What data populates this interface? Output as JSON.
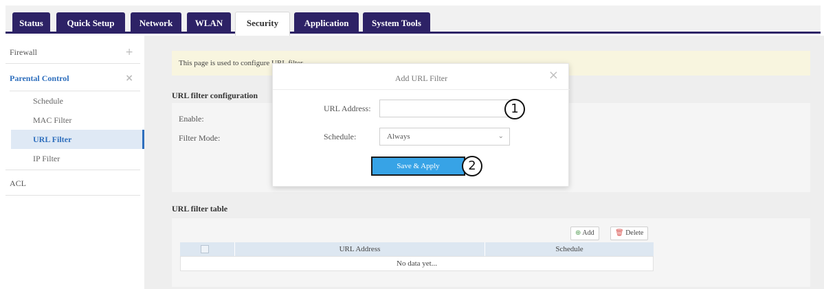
{
  "nav": {
    "tabs": [
      {
        "label": "Status"
      },
      {
        "label": "Quick Setup"
      },
      {
        "label": "Network"
      },
      {
        "label": "WLAN"
      },
      {
        "label": "Security"
      },
      {
        "label": "Application"
      },
      {
        "label": "System Tools"
      }
    ],
    "active_tab": "Security"
  },
  "sidebar": {
    "firewall": {
      "label": "Firewall",
      "sign": "+"
    },
    "parental": {
      "label": "Parental Control",
      "sign": "×"
    },
    "sub_items": [
      {
        "label": "Schedule"
      },
      {
        "label": "MAC Filter"
      },
      {
        "label": "URL Filter"
      },
      {
        "label": "IP Filter"
      }
    ],
    "acl": {
      "label": "ACL"
    }
  },
  "main": {
    "notice": "This page is used to configure URL filter.",
    "config_title": "URL filter configuration",
    "enable_label": "Enable:",
    "filter_mode_label": "Filter Mode:",
    "table_title": "URL filter table",
    "add_label": "Add",
    "delete_label": "Delete",
    "columns": [
      "URL Address",
      "Schedule"
    ],
    "empty_text": "No data yet..."
  },
  "modal": {
    "title": "Add URL Filter",
    "close": "×",
    "url_label": "URL Address:",
    "url_value": "",
    "schedule_label": "Schedule:",
    "schedule_value": "Always",
    "save_label": "Save & Apply",
    "marker_1": "1",
    "marker_2": "2"
  },
  "colors": {
    "nav_bg": "#2d2266",
    "accent": "#2f6fbd",
    "button": "#37a3e6",
    "notice_bg": "#f8f5df"
  }
}
